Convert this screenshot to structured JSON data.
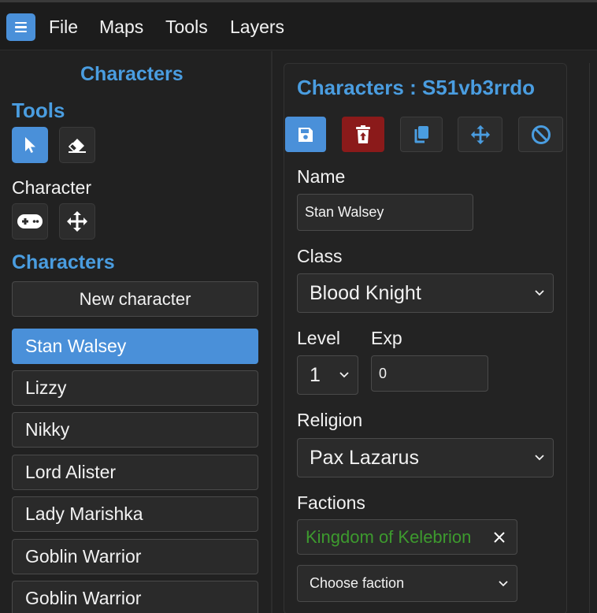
{
  "menubar": {
    "items": [
      "File",
      "Maps",
      "Tools",
      "Layers"
    ]
  },
  "left": {
    "title": "Characters",
    "tools_heading": "Tools",
    "character_label": "Character",
    "characters_heading": "Characters",
    "new_character_label": "New character",
    "characters": [
      "Stan Walsey",
      "Lizzy",
      "Nikky",
      "Lord Alister",
      "Lady Marishka",
      "Goblin Warrior",
      "Goblin Warrior"
    ],
    "selected_index": 0
  },
  "editor": {
    "title": "Characters : S51vb3rrdo",
    "name_label": "Name",
    "name_value": "Stan Walsey",
    "class_label": "Class",
    "class_value": "Blood Knight",
    "level_label": "Level",
    "level_value": "1",
    "exp_label": "Exp",
    "exp_value": "0",
    "religion_label": "Religion",
    "religion_value": "Pax Lazarus",
    "factions_label": "Factions",
    "faction_tag": "Kingdom of Kelebrion",
    "choose_faction": "Choose faction"
  },
  "colors": {
    "accent": "#4a90d9",
    "heading_blue": "#4a9de0",
    "danger": "#8b1a1a",
    "faction_green": "#3d9a2e"
  },
  "icons": [
    "menu-icon",
    "pointer-icon",
    "eraser-icon",
    "gamepad-icon",
    "move-icon",
    "save-icon",
    "delete-icon",
    "copy-icon",
    "cancel-icon",
    "close-icon",
    "chevron-down-icon"
  ]
}
